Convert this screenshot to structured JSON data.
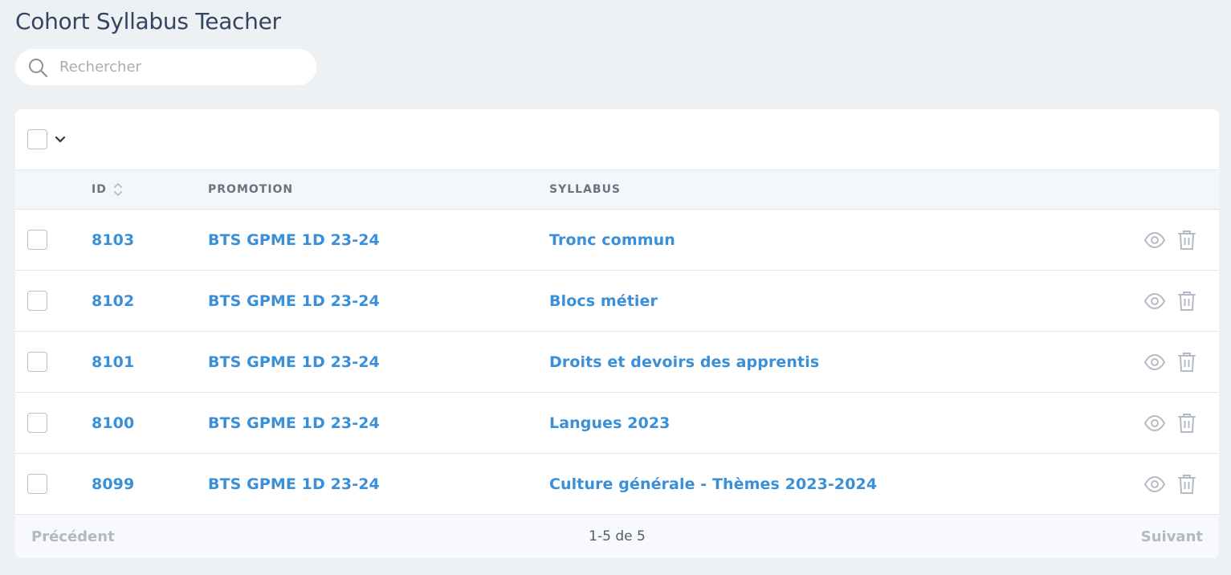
{
  "page": {
    "title": "Cohort Syllabus Teacher"
  },
  "search": {
    "placeholder": "Rechercher",
    "value": ""
  },
  "table": {
    "columns": {
      "id": "ID",
      "promotion": "PROMOTION",
      "syllabus": "SYLLABUS"
    },
    "rows": [
      {
        "id": "8103",
        "promotion": "BTS GPME 1D 23-24",
        "syllabus": "Tronc commun"
      },
      {
        "id": "8102",
        "promotion": "BTS GPME 1D 23-24",
        "syllabus": "Blocs métier"
      },
      {
        "id": "8101",
        "promotion": "BTS GPME 1D 23-24",
        "syllabus": "Droits et devoirs des apprentis"
      },
      {
        "id": "8100",
        "promotion": "BTS GPME 1D 23-24",
        "syllabus": "Langues 2023"
      },
      {
        "id": "8099",
        "promotion": "BTS GPME 1D 23-24",
        "syllabus": "Culture générale - Thèmes 2023-2024"
      }
    ]
  },
  "pagination": {
    "previous": "Précédent",
    "info": "1-5 de 5",
    "next": "Suivant"
  },
  "icons": {
    "search": "search-icon",
    "bulk": "chevron-down-icon",
    "sort": "sort-icon",
    "view": "eye-icon",
    "delete": "trash-icon"
  },
  "colors": {
    "link": "#3a8fd9",
    "background": "#eef1f4",
    "muted": "#b4b9c0"
  }
}
